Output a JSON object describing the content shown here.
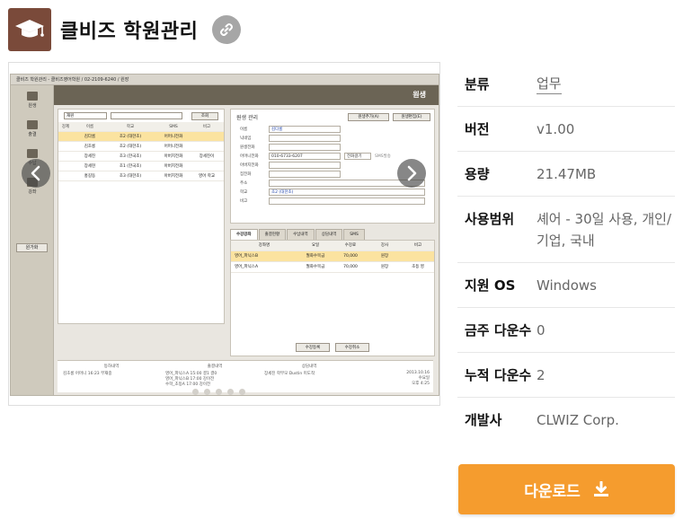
{
  "app": {
    "title": "클비즈 학원관리",
    "icon": "graduation-cap-icon",
    "icon_bg": "#7a4a3a",
    "link_icon": "link-icon"
  },
  "screenshot": {
    "window_title": "클비즈 학원관리 - 클비즈영어학원 / 02-2109-6240 / 원장",
    "page_heading": "원생",
    "nav": [
      "원생",
      "출결",
      "수납",
      "강좌"
    ],
    "nav_button": "원가화",
    "search_select": "재원",
    "search_button": "조회",
    "list_headers": [
      "강제",
      "이름",
      "학교",
      "SMS",
      "비고"
    ],
    "list_rows": [
      [
        "",
        "김다롬",
        "초2 (대한초)",
        "어머니전화",
        ""
      ],
      [
        "",
        "김초롱",
        "초2 (대한초)",
        "어머니전화",
        ""
      ],
      [
        "",
        "장세진",
        "초3 (한국초)",
        "아버지전화",
        "장세진이"
      ],
      [
        "",
        "장세현",
        "초1 (한국초)",
        "아버지전화",
        ""
      ],
      [
        "",
        "홍길동",
        "초3 (대한초)",
        "아버지전화",
        "영어 학교"
      ]
    ],
    "detail_title": "원생 관리",
    "detail_btn_add": "원생추가(A)",
    "detail_btn_edit": "원생편집(E)",
    "fields": [
      {
        "label": "이름",
        "value": "김다롬"
      },
      {
        "label": "닉네임",
        "value": ""
      },
      {
        "label": "원생전화",
        "value": ""
      },
      {
        "label": "어머니전화",
        "value": "010-6733-6207"
      },
      {
        "label": "아버지전화",
        "value": ""
      },
      {
        "label": "집전화",
        "value": ""
      },
      {
        "label": "주소",
        "value": ""
      },
      {
        "label": "학교",
        "value": "초2 (대한초)"
      },
      {
        "label": "비고",
        "value": ""
      }
    ],
    "call_button": "전화걸기",
    "sms_label": "SMS발송",
    "tabs": [
      "수강강좌",
      "출결현황",
      "수납내역",
      "상담내역",
      "SMS"
    ],
    "grid_headers": [
      "강좌명",
      "요일",
      "수강료",
      "강사",
      "비고"
    ],
    "grid_rows": [
      [
        "영어_파닉스B",
        "월화수목금",
        "70,000",
        "원장",
        ""
      ],
      [
        "영어_파닉스A",
        "월화수목금",
        "70,000",
        "원장",
        "초등 영"
      ]
    ],
    "grid_btn_add": "수강등록",
    "grid_btn_cancel": "수강취소",
    "status_headers": [
      "등하내역",
      "출결내역",
      "상담내역"
    ],
    "status_left": "김초롱 어머니    16:23    부재중",
    "status_mid": [
      "영어_파닉스A   15:00   결1 결0",
      "영어_파닉스B   17:00   강이전",
      "수학_초등A   17:00   강이전"
    ],
    "status_right": "장세진 학부모    Dustin    미도착",
    "status_date": "2013.10.16",
    "status_day": "수요일",
    "status_time": "오후 4:25"
  },
  "carousel": {
    "prev_icon": "chevron-left-icon",
    "next_icon": "chevron-right-icon",
    "dot_count": 5
  },
  "info": {
    "category_label": "분류",
    "category_value": "업무",
    "version_label": "버전",
    "version_value": "v1.00",
    "size_label": "용량",
    "size_value": "21.47MB",
    "scope_label": "사용범위",
    "scope_value": "셰어 - 30일 사용, 개인/기업, 국내",
    "os_label": "지원 OS",
    "os_value": "Windows",
    "weekly_label": "금주 다운수",
    "weekly_value": "0",
    "total_label": "누적 다운수",
    "total_value": "2",
    "dev_label": "개발사",
    "dev_value": "CLWIZ Corp."
  },
  "download": {
    "label": "다운로드",
    "icon": "download-icon",
    "color": "#f59c2e"
  }
}
